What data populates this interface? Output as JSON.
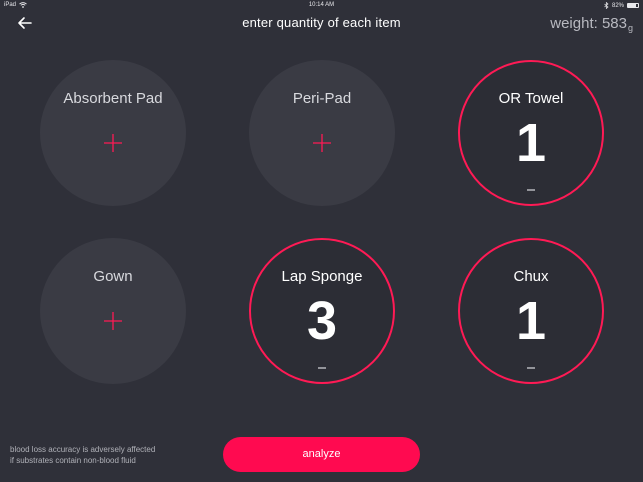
{
  "status_bar": {
    "device": "iPad",
    "time": "10:14 AM",
    "battery": "82%",
    "battery_level": 0.82
  },
  "header": {
    "title": "enter quantity of each item",
    "weight_label": "weight: 583",
    "weight_unit": "g"
  },
  "items": [
    {
      "label": "Absorbent Pad",
      "quantity": null,
      "selected": false
    },
    {
      "label": "Peri-Pad",
      "quantity": null,
      "selected": false
    },
    {
      "label": "OR Towel",
      "quantity": "1",
      "selected": true
    },
    {
      "label": "Gown",
      "quantity": null,
      "selected": false
    },
    {
      "label": "Lap Sponge",
      "quantity": "3",
      "selected": true
    },
    {
      "label": "Chux",
      "quantity": "1",
      "selected": true
    }
  ],
  "footer": {
    "disclaimer_line1": "blood loss accuracy is adversely affected",
    "disclaimer_line2": "if substrates contain non-blood fluid",
    "analyze_label": "analyze"
  },
  "colors": {
    "background": "#2f3039",
    "accent": "#ff0a50",
    "circle_fill": "#3a3b44"
  }
}
